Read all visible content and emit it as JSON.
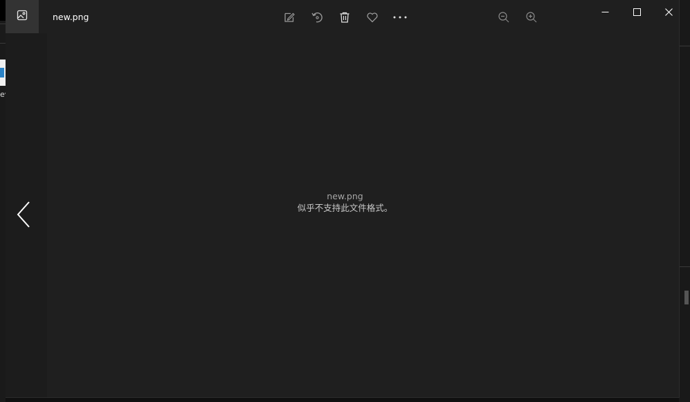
{
  "background_window": {
    "left_label": "ev"
  },
  "titlebar": {
    "file_name": "new.png",
    "app_icon": "photos-app-icon"
  },
  "toolbar": {
    "items": [
      {
        "name": "edit-icon"
      },
      {
        "name": "rotate-icon"
      },
      {
        "name": "delete-icon"
      },
      {
        "name": "favorite-icon"
      },
      {
        "name": "more-icon"
      },
      {
        "name": "zoom-out-icon"
      },
      {
        "name": "zoom-in-icon"
      }
    ]
  },
  "window_controls": [
    "minimize-icon",
    "maximize-icon",
    "close-icon"
  ],
  "content": {
    "file_name": "new.png",
    "error_message": "似乎不支持此文件格式。"
  },
  "colors": {
    "window_bg": "#1f1f1f",
    "titlebar_button_bg": "#333333",
    "icon_gray": "#9a9a9a",
    "text_white": "#ffffff"
  }
}
